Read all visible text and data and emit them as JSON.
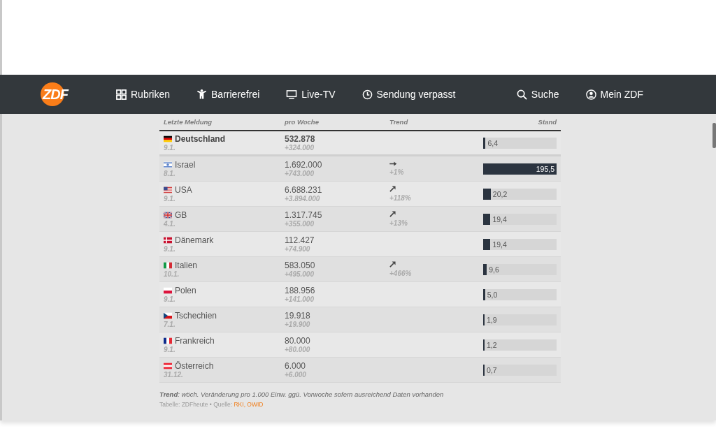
{
  "logo": {
    "text": "ZDF"
  },
  "nav": {
    "items": [
      {
        "label": "Rubriken"
      },
      {
        "label": "Barrierefrei"
      },
      {
        "label": "Live-TV"
      },
      {
        "label": "Sendung verpasst"
      }
    ],
    "right_items": [
      {
        "label": "Suche"
      },
      {
        "label": "Mein ZDF"
      }
    ]
  },
  "table": {
    "columns": [
      "Letzte Meldung",
      "pro Woche",
      "Trend",
      "Stand"
    ],
    "rows": [
      {
        "country": "Deutschland",
        "date": "9.1.",
        "highlighted": true,
        "weekly": "532.878",
        "change": "+324.000",
        "level": 0.033,
        "reading": "6,4"
      },
      {
        "country": "Israel",
        "date": "8.1.",
        "highlighted": false,
        "weekly": "1.692.000",
        "change": "+743.000",
        "trend": {
          "kind": "flat",
          "text": "+1%"
        },
        "level": 1.0,
        "reading": "195,5"
      },
      {
        "country": "USA",
        "date": "9.1.",
        "highlighted": false,
        "weekly": "6.688.231",
        "change": "+3.894.000",
        "trend": {
          "kind": "up",
          "text": "+118%"
        },
        "level": 0.103,
        "reading": "20,2"
      },
      {
        "country": "GB",
        "date": "4.1.",
        "highlighted": false,
        "weekly": "1.317.745",
        "change": "+355.000",
        "trend": {
          "kind": "up",
          "text": "+13%"
        },
        "level": 0.099,
        "reading": "19,4"
      },
      {
        "country": "Dänemark",
        "date": "9.1.",
        "highlighted": false,
        "weekly": "112.427",
        "change": "+74.900",
        "level": 0.099,
        "reading": "19,4"
      },
      {
        "country": "Italien",
        "date": "10.1.",
        "highlighted": false,
        "weekly": "583.050",
        "change": "+495.000",
        "trend": {
          "kind": "up",
          "text": "+466%"
        },
        "level": 0.049,
        "reading": "9,6"
      },
      {
        "country": "Polen",
        "date": "9.1.",
        "highlighted": false,
        "weekly": "188.956",
        "change": "+141.000",
        "level": 0.026,
        "reading": "5,0"
      },
      {
        "country": "Tschechien",
        "date": "7.1.",
        "highlighted": false,
        "weekly": "19.918",
        "change": "+19.900",
        "level": 0.01,
        "reading": "1,9"
      },
      {
        "country": "Frankreich",
        "date": "9.1.",
        "highlighted": false,
        "weekly": "80.000",
        "change": "+80.000",
        "level": 0.006,
        "reading": "1,2"
      },
      {
        "country": "Österreich",
        "date": "31.12.",
        "highlighted": false,
        "weekly": "6.000",
        "change": "+6.000",
        "level": 0.004,
        "reading": "0,7"
      }
    ]
  },
  "footnote": "**Trend**: wöch. Veränderung pro 1.000 Einw. ggü. Vorwoche sofern ausreichend Daten vorhanden",
  "source": {
    "text": "Tabelle: ZDFheute • Quelle:",
    "link": "RKI, OWID"
  }
}
